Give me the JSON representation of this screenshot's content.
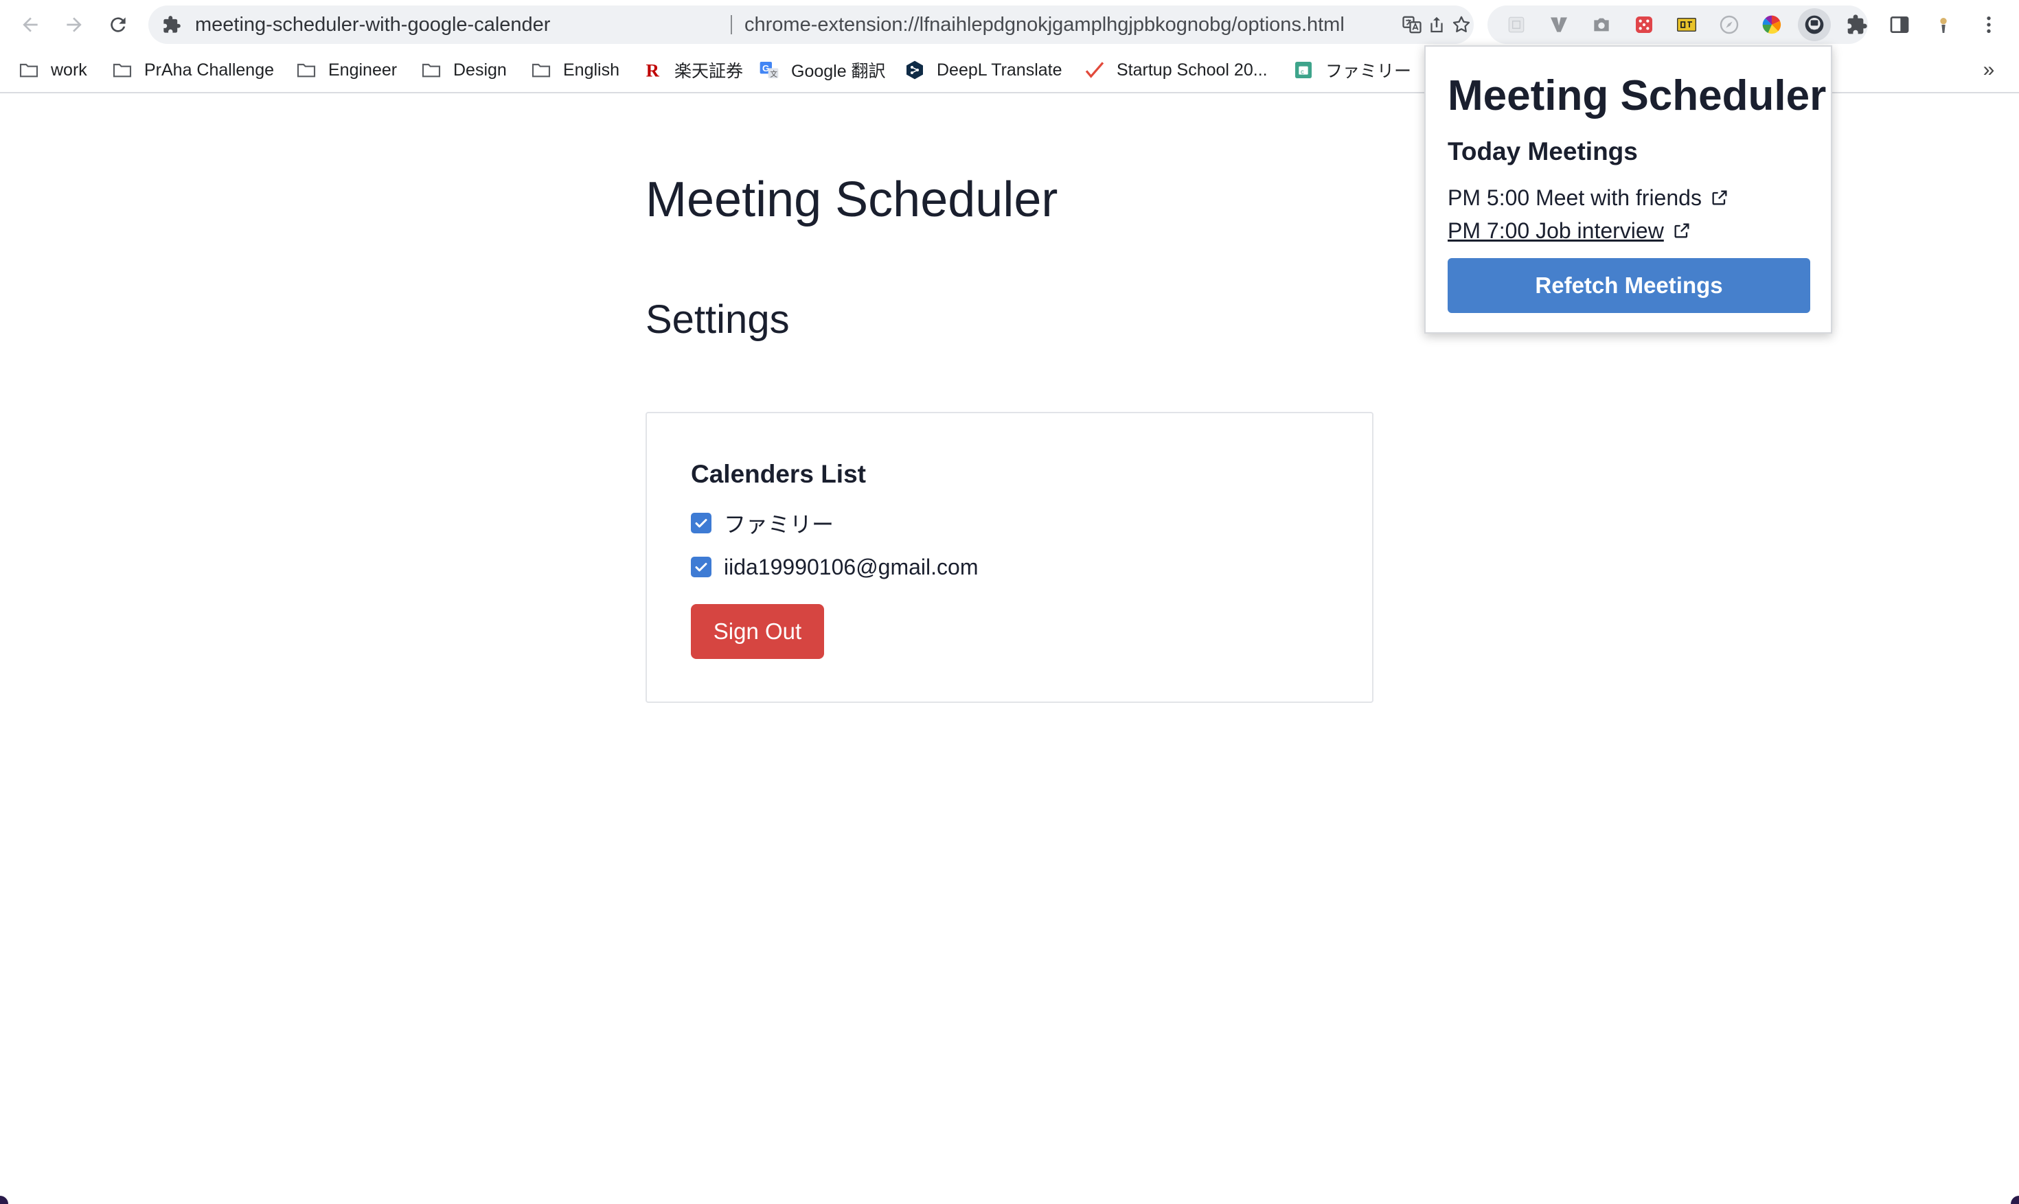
{
  "browser": {
    "omnibox": {
      "site_name": "meeting-scheduler-with-google-calender",
      "url": "chrome-extension://lfnaihlepdgnokjgamplhgjpbkognobg/options.html"
    },
    "toolbar_icons": [
      "back-arrow-icon",
      "forward-arrow-icon",
      "reload-icon",
      "puzzle-icon",
      "translate-icon",
      "share-icon",
      "star-icon",
      "more-vert-icon"
    ],
    "bookmarks": [
      {
        "label": "work",
        "icon": "folder-icon"
      },
      {
        "label": "PrAha Challenge",
        "icon": "folder-icon"
      },
      {
        "label": "Engineer",
        "icon": "folder-icon"
      },
      {
        "label": "Design",
        "icon": "folder-icon"
      },
      {
        "label": "English",
        "icon": "folder-icon"
      },
      {
        "label": "楽天証券",
        "icon": "rakuten-icon"
      },
      {
        "label": "Google 翻訳",
        "icon": "google-translate-icon"
      },
      {
        "label": "DeepL Translate",
        "icon": "deepl-icon"
      },
      {
        "label": "Startup School 20...",
        "icon": "checkmark-icon"
      },
      {
        "label": "ファミリー",
        "icon": "calendar-icon"
      }
    ],
    "bookmarks_more": "»"
  },
  "page": {
    "title": "Meeting Scheduler",
    "settings_heading": "Settings",
    "calendars": {
      "heading": "Calenders List",
      "items": [
        {
          "label": "ファミリー",
          "checked": true
        },
        {
          "label": "iida19990106@gmail.com",
          "checked": true
        }
      ]
    },
    "sign_out_label": "Sign Out"
  },
  "popup": {
    "title": "Meeting Scheduler",
    "subtitle": "Today Meetings",
    "meetings": [
      {
        "text": "PM 5:00 Meet with friends",
        "underlined": false
      },
      {
        "text": "PM 7:00 Job interview",
        "underlined": true
      }
    ],
    "refetch_label": "Refetch Meetings"
  },
  "colors": {
    "checkbox": "#3e7bd4",
    "sign_out": "#d64541",
    "refetch": "#4680cc",
    "omnibox_bg": "#eff1f4"
  }
}
